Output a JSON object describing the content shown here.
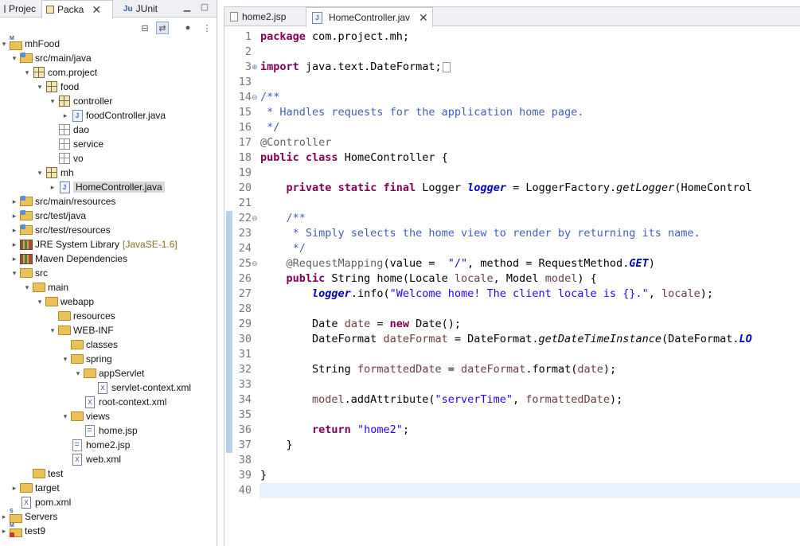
{
  "left_tabs": [
    {
      "label": "Projec",
      "icon": "project-explorer-icon"
    },
    {
      "label": "Packa",
      "icon": "package-explorer-icon",
      "active": true
    },
    {
      "label": "JUnit",
      "icon": "junit-icon"
    }
  ],
  "tree": [
    {
      "label": "mhFood",
      "indent": 0,
      "arrow": "open",
      "icon": "maven-project-icon"
    },
    {
      "label": "src/main/java",
      "indent": 1,
      "arrow": "open",
      "icon": "source-folder-icon"
    },
    {
      "label": "com.project",
      "indent": 2,
      "arrow": "open",
      "icon": "package-icon"
    },
    {
      "label": "food",
      "indent": 3,
      "arrow": "open",
      "icon": "package-icon"
    },
    {
      "label": "controller",
      "indent": 4,
      "arrow": "open",
      "icon": "package-icon"
    },
    {
      "label": "foodController.java",
      "indent": 5,
      "arrow": "closed",
      "icon": "java-file-icon"
    },
    {
      "label": "dao",
      "indent": 4,
      "arrow": "",
      "icon": "empty-package-icon"
    },
    {
      "label": "service",
      "indent": 4,
      "arrow": "",
      "icon": "empty-package-icon"
    },
    {
      "label": "vo",
      "indent": 4,
      "arrow": "",
      "icon": "empty-package-icon"
    },
    {
      "label": "mh",
      "indent": 3,
      "arrow": "open",
      "icon": "package-icon"
    },
    {
      "label": "HomeController.java",
      "indent": 4,
      "arrow": "closed",
      "icon": "java-file-icon",
      "selected": true
    },
    {
      "label": "src/main/resources",
      "indent": 1,
      "arrow": "closed",
      "icon": "source-folder-icon"
    },
    {
      "label": "src/test/java",
      "indent": 1,
      "arrow": "closed",
      "icon": "source-folder-icon"
    },
    {
      "label": "src/test/resources",
      "indent": 1,
      "arrow": "closed",
      "icon": "source-folder-icon"
    },
    {
      "label": "JRE System Library",
      "decoration": "[JavaSE-1.6]",
      "indent": 1,
      "arrow": "closed",
      "icon": "library-icon"
    },
    {
      "label": "Maven Dependencies",
      "indent": 1,
      "arrow": "closed",
      "icon": "library-icon"
    },
    {
      "label": "src",
      "indent": 1,
      "arrow": "open",
      "icon": "folder-icon"
    },
    {
      "label": "main",
      "indent": 2,
      "arrow": "open",
      "icon": "folder-icon"
    },
    {
      "label": "webapp",
      "indent": 3,
      "arrow": "open",
      "icon": "folder-icon"
    },
    {
      "label": "resources",
      "indent": 4,
      "arrow": "",
      "icon": "folder-icon"
    },
    {
      "label": "WEB-INF",
      "indent": 4,
      "arrow": "open",
      "icon": "folder-icon"
    },
    {
      "label": "classes",
      "indent": 5,
      "arrow": "",
      "icon": "folder-icon"
    },
    {
      "label": "spring",
      "indent": 5,
      "arrow": "open",
      "icon": "folder-icon"
    },
    {
      "label": "appServlet",
      "indent": 6,
      "arrow": "open",
      "icon": "folder-icon"
    },
    {
      "label": "servlet-context.xml",
      "indent": 7,
      "arrow": "",
      "icon": "spring-xml-icon"
    },
    {
      "label": "root-context.xml",
      "indent": 6,
      "arrow": "",
      "icon": "spring-xml-icon"
    },
    {
      "label": "views",
      "indent": 5,
      "arrow": "open",
      "icon": "folder-icon"
    },
    {
      "label": "home.jsp",
      "indent": 6,
      "arrow": "",
      "icon": "jsp-file-icon"
    },
    {
      "label": "home2.jsp",
      "indent": 5,
      "arrow": "",
      "icon": "jsp-file-icon"
    },
    {
      "label": "web.xml",
      "indent": 5,
      "arrow": "",
      "icon": "xml-file-icon"
    },
    {
      "label": "test",
      "indent": 2,
      "arrow": "",
      "icon": "folder-icon"
    },
    {
      "label": "target",
      "indent": 1,
      "arrow": "closed",
      "icon": "folder-icon"
    },
    {
      "label": "pom.xml",
      "indent": 1,
      "arrow": "",
      "icon": "maven-pom-icon"
    },
    {
      "label": "Servers",
      "indent": 0,
      "arrow": "closed",
      "icon": "servers-icon"
    },
    {
      "label": "test9",
      "indent": 0,
      "arrow": "closed",
      "icon": "maven-project-error-icon"
    }
  ],
  "editor_tabs": [
    {
      "label": "home2.jsp",
      "icon": "jsp-file-icon"
    },
    {
      "label": "HomeController.jav",
      "icon": "java-file-icon",
      "active": true
    }
  ],
  "line_numbers": [
    "1",
    "2",
    "3",
    "13",
    "14",
    "15",
    "16",
    "17",
    "18",
    "19",
    "20",
    "21",
    "22",
    "23",
    "24",
    "25",
    "26",
    "27",
    "28",
    "29",
    "30",
    "31",
    "32",
    "33",
    "34",
    "35",
    "36",
    "37",
    "38",
    "39",
    "40"
  ],
  "code_lines": [
    [
      [
        "kw",
        "package"
      ],
      [
        "",
        "com.project.mh;"
      ]
    ],
    [],
    [
      [
        "kw",
        "import"
      ],
      [
        "",
        "java.text.DateFormat;"
      ]
    ],
    [],
    [
      [
        "cm",
        "/**"
      ]
    ],
    [
      [
        "cm",
        "* Handles requests for the application home page."
      ]
    ],
    [
      [
        "cm",
        "*/"
      ]
    ],
    [
      [
        "ann",
        "@Controller"
      ]
    ],
    [
      [
        "kw",
        "public"
      ],
      [
        "kw",
        "class"
      ],
      [
        "",
        "HomeController {"
      ]
    ],
    [],
    [
      [
        "kw",
        "private"
      ],
      [
        "kw",
        "static"
      ],
      [
        "kw",
        "final"
      ],
      [
        "",
        "Logger"
      ],
      [
        "sfld",
        "logger"
      ],
      [
        "",
        "= LoggerFactory."
      ],
      [
        "it",
        "getLogger"
      ],
      [
        "",
        "(HomeControl"
      ]
    ],
    [],
    [
      [
        "cm",
        "/**"
      ]
    ],
    [
      [
        "cm",
        "* Simply selects the home view to render by returning its name."
      ]
    ],
    [
      [
        "cm",
        "*/"
      ]
    ],
    [
      [
        "ann",
        "@RequestMapping"
      ],
      [
        "",
        "(value = "
      ],
      [
        "str",
        "\"/\""
      ],
      [
        "",
        ", method = RequestMethod."
      ],
      [
        "sfld",
        "GET"
      ],
      [
        "",
        ")"
      ]
    ],
    [
      [
        "kw",
        "public"
      ],
      [
        "",
        "String home(Locale"
      ],
      [
        "var",
        "locale"
      ],
      [
        "",
        ", Model"
      ],
      [
        "var",
        "model"
      ],
      [
        "",
        ") {"
      ]
    ],
    [
      [
        "sfld",
        "logger"
      ],
      [
        "",
        ".info("
      ],
      [
        "str",
        "\"Welcome home! The client locale is {}.\""
      ],
      [
        "",
        ","
      ],
      [
        "var",
        "locale"
      ],
      [
        "",
        ");"
      ]
    ],
    [],
    [
      [
        "",
        "Date"
      ],
      [
        "var",
        "date"
      ],
      [
        "",
        "="
      ],
      [
        "kw",
        "new"
      ],
      [
        "",
        "Date();"
      ]
    ],
    [
      [
        "",
        "DateFormat"
      ],
      [
        "var",
        "dateFormat"
      ],
      [
        "",
        "= DateFormat."
      ],
      [
        "it",
        "getDateTimeInstance"
      ],
      [
        "",
        "(DateFormat."
      ],
      [
        "sfld",
        "LO"
      ]
    ],
    [],
    [
      [
        "",
        "String"
      ],
      [
        "var",
        "formattedDate"
      ],
      [
        "",
        "="
      ],
      [
        "var",
        "dateFormat"
      ],
      [
        "",
        ".format("
      ],
      [
        "var",
        "date"
      ],
      [
        "",
        ");"
      ]
    ],
    [],
    [
      [
        "var",
        "model"
      ],
      [
        "",
        ".addAttribute("
      ],
      [
        "str",
        "\"serverTime\""
      ],
      [
        "",
        ","
      ],
      [
        "var",
        "formattedDate"
      ],
      [
        "",
        ");"
      ]
    ],
    [],
    [
      [
        "kw",
        "return"
      ],
      [
        "str",
        "\"home2\""
      ],
      [
        "",
        ";"
      ]
    ],
    [
      [
        "",
        "}"
      ]
    ],
    [],
    [
      [
        "",
        "}"
      ]
    ],
    []
  ],
  "code_indent": [
    0,
    0,
    0,
    0,
    0,
    1,
    1,
    0,
    0,
    0,
    4,
    0,
    4,
    5,
    5,
    4,
    4,
    8,
    0,
    8,
    8,
    0,
    8,
    0,
    8,
    0,
    8,
    4,
    0,
    0,
    0
  ],
  "folded_lines": [
    "3"
  ],
  "fold_markers": {
    "3": "plus",
    "14": "minus",
    "22": "minus",
    "25": "minus"
  }
}
